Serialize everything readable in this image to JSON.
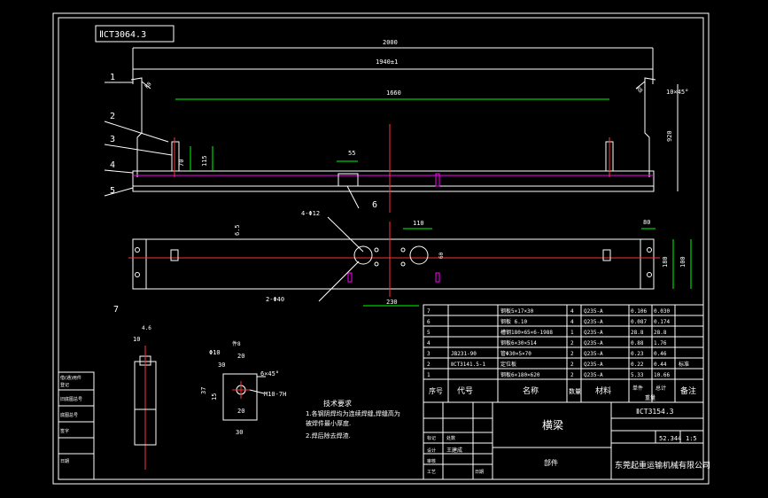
{
  "drawing": {
    "stamp_top": "ⅡCT3064.3",
    "dims": {
      "overall": "2000",
      "inner": "1940±1",
      "span": "1660",
      "chamfer": "10×45°",
      "height": "920",
      "h70": "70",
      "h115": "115",
      "w55": "55",
      "plan_w110": "110",
      "plan_w230": "230",
      "plan_d60": "60",
      "plan_w80": "80",
      "plan_h180": "180",
      "plan_h100": "100",
      "plan_left_a": "6.5",
      "plan_hole_a": "4-Φ12",
      "plan_hole_b": "2-Φ40",
      "detail7_top": "10",
      "detail7_w": "4.6",
      "det_w20": "20",
      "det_w10": "Φ10",
      "det_w30": "30",
      "det_h37": "37",
      "det_h15": "15",
      "det_b30": "30",
      "det_b20": "20",
      "det_chamfer": "6×45°",
      "det_thread": "M10-7H",
      "det_top": "件8"
    },
    "balloons": [
      "1",
      "2",
      "3",
      "4",
      "5",
      "6",
      "7"
    ],
    "notes": {
      "title": "技术要求",
      "line1": "1.各钢阴焊均为连续焊缝,焊缝高为",
      "line2": "  被焊件最小厚度.",
      "line3": "2.焊后除去焊渣."
    },
    "bom": {
      "rows": [
        {
          "no": "7",
          "code": "",
          "name": "钢板5×17×30",
          "qty": "4",
          "material": "Q235-A",
          "unit": "0.106",
          "total": "0.030",
          "note": ""
        },
        {
          "no": "6",
          "code": "",
          "name": "钢板 6.10",
          "qty": "4",
          "material": "Q235-A",
          "unit": "0.087",
          "total": "0.174",
          "note": ""
        },
        {
          "no": "5",
          "code": "",
          "name": "槽钢180×65×6-1988",
          "qty": "1",
          "material": "Q235-A",
          "unit": "28.8",
          "total": "28.8",
          "note": ""
        },
        {
          "no": "4",
          "code": "",
          "name": "钢板6×30×514",
          "qty": "2",
          "material": "Q235-A",
          "unit": "0.88",
          "total": "1.76",
          "note": ""
        },
        {
          "no": "3",
          "code": "JB231-90",
          "name": "管Φ30×5×70",
          "qty": "2",
          "material": "Q235-A",
          "unit": "0.23",
          "total": "0.46",
          "note": ""
        },
        {
          "no": "2",
          "code": "ⅡCT3141.5-1",
          "name": "定位板",
          "qty": "2",
          "material": "Q235-A",
          "unit": "0.22",
          "total": "0.44",
          "note": "标准"
        },
        {
          "no": "1",
          "code": "",
          "name": "钢板6×180×620",
          "qty": "2",
          "material": "Q235-A",
          "unit": "5.33",
          "total": "10.66",
          "note": ""
        }
      ],
      "headers": {
        "no": "序号",
        "code": "代号",
        "name": "名称",
        "qty": "数量",
        "material": "材料",
        "unit": "单件",
        "total": "总计",
        "weight": "重量",
        "note": "备注"
      }
    },
    "title_block": {
      "part_name": "横梁",
      "drawing_no": "ⅡCT3154.3",
      "weight": "52.344",
      "scale": "1:5",
      "company": "东莞起重运输机械有限公司",
      "kind": "部件",
      "designer": "王建成",
      "label_mark": "标记",
      "label_count": "处数",
      "label_design": "设计",
      "label_check": "审核",
      "label_process": "工艺",
      "label_date": "日期"
    },
    "side_block": {
      "r1": "借(通)用件",
      "r2": "登记",
      "r3": "旧底图总号",
      "r4": "底图总号",
      "r5": "签字",
      "r6": "日期"
    }
  }
}
